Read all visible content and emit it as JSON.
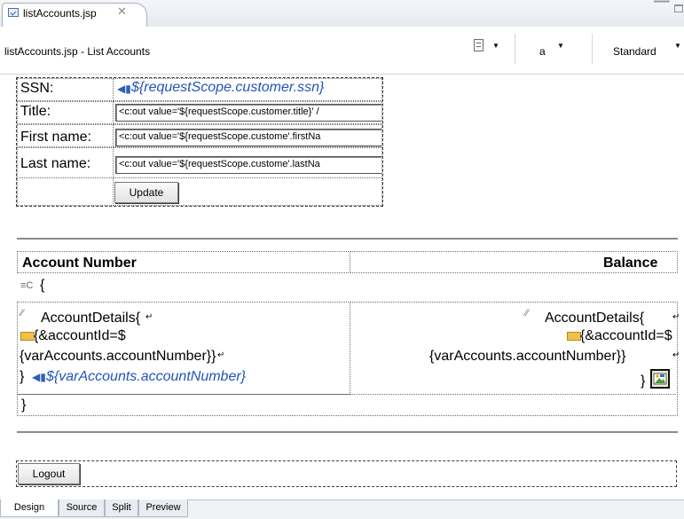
{
  "editor_tab": {
    "title": "listAccounts.jsp",
    "close_glyph": "✕"
  },
  "window_controls": {
    "minimize_glyph": "▭",
    "maximize_glyph": "□"
  },
  "toolbar": {
    "page_title": "listAccounts.jsp - List Accounts",
    "font_size": "a",
    "mode": "Standard"
  },
  "form": {
    "ssn_label": "SSN:",
    "ssn_value": "${requestScope.customer.ssn}",
    "title_label": "Title:",
    "title_value": "<c:out value='${requestScope.customer.title}' /",
    "first_name_label": "First name:",
    "first_name_value": "<c:out value='${requestScope.custome'.firstNa",
    "last_name_label": "Last name:",
    "last_name_value": "<c:out value='${requestScope.custome'.lastNa",
    "update_button": "Update"
  },
  "accounts_table": {
    "header_account": "Account Number",
    "header_balance": "Balance",
    "loop_open": "{",
    "left_line1": "AccountDetails{",
    "left_line2": "{&accountId=$",
    "left_line3": "{varAccounts.accountNumber}}",
    "left_line4_brace": "}",
    "left_expr": "${varAccounts.accountNumber}",
    "right_line1": "AccountDetails{",
    "right_line2": "{&accountId=$",
    "right_line3": "{varAccounts.accountNumber}}",
    "right_line4_brace": "}",
    "loop_close": "}"
  },
  "logout_button": "Logout",
  "view_tabs": [
    "Design",
    "Source",
    "Split",
    "Preview"
  ],
  "active_view_tab": "Design"
}
